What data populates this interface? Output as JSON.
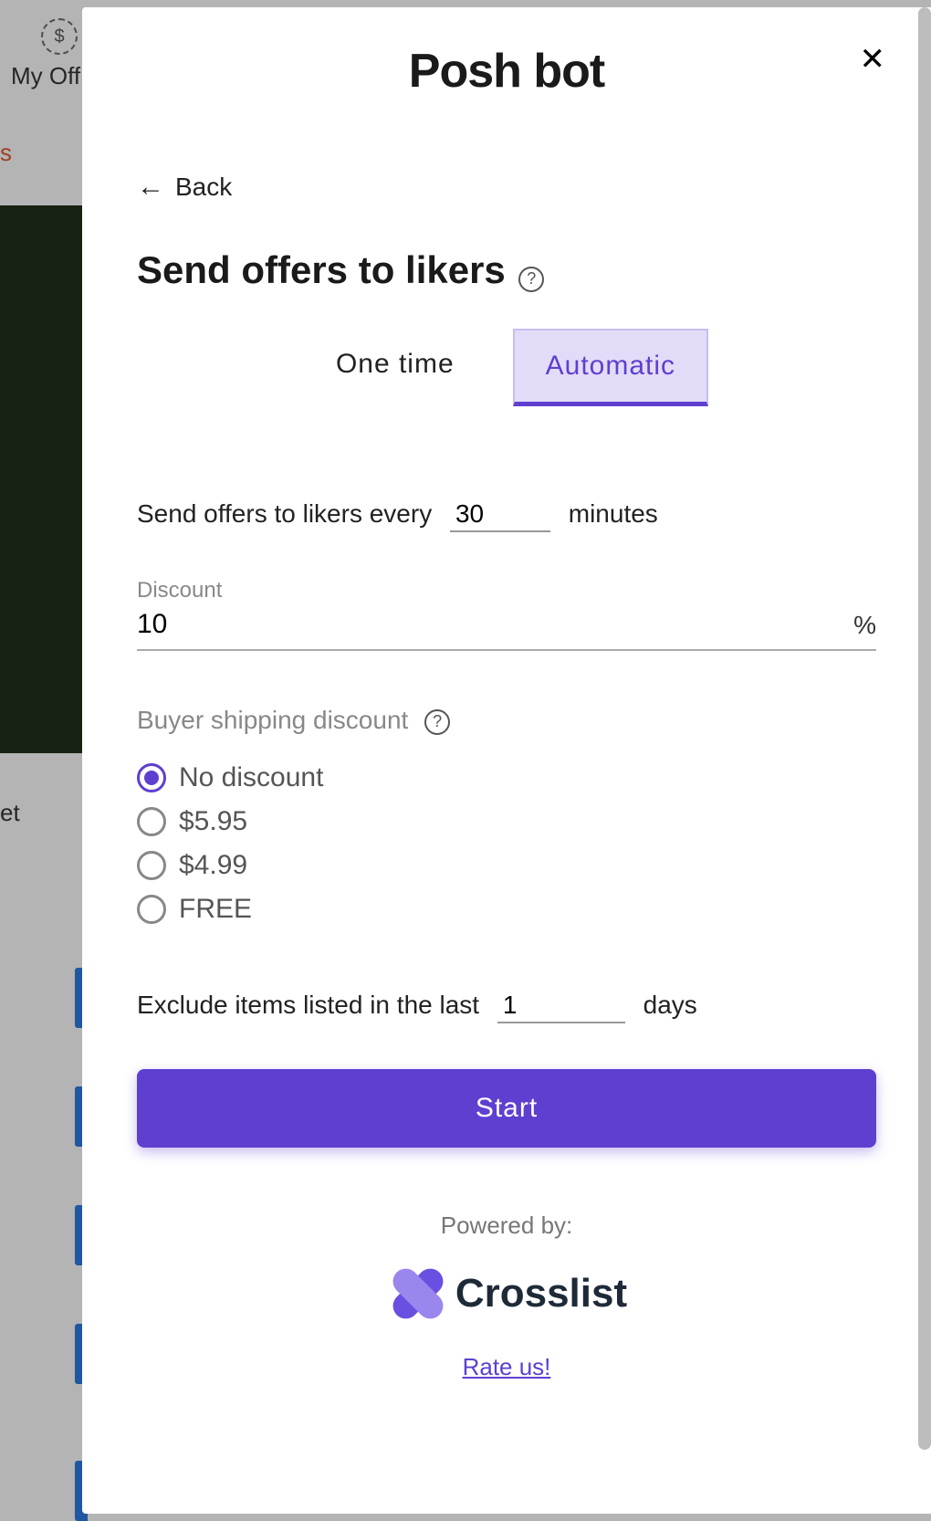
{
  "background": {
    "my_offers": "My Off",
    "orange_tab": "s",
    "et_text": "et"
  },
  "panel": {
    "title": "Posh bot",
    "back_label": "Back",
    "section_title": "Send offers to likers",
    "tabs": {
      "one_time": "One time",
      "automatic": "Automatic"
    },
    "interval": {
      "prefix": "Send offers to likers every",
      "value": "30",
      "suffix": "minutes"
    },
    "discount": {
      "label": "Discount",
      "value": "10",
      "unit": "%"
    },
    "shipping": {
      "label": "Buyer shipping discount",
      "options": [
        "No discount",
        "$5.95",
        "$4.99",
        "FREE"
      ],
      "selected_index": 0
    },
    "exclude": {
      "prefix": "Exclude items listed in the last",
      "value": "1",
      "suffix": "days"
    },
    "start_label": "Start",
    "powered_by": "Powered by:",
    "brand": "Crosslist",
    "rate_label": "Rate us!"
  }
}
